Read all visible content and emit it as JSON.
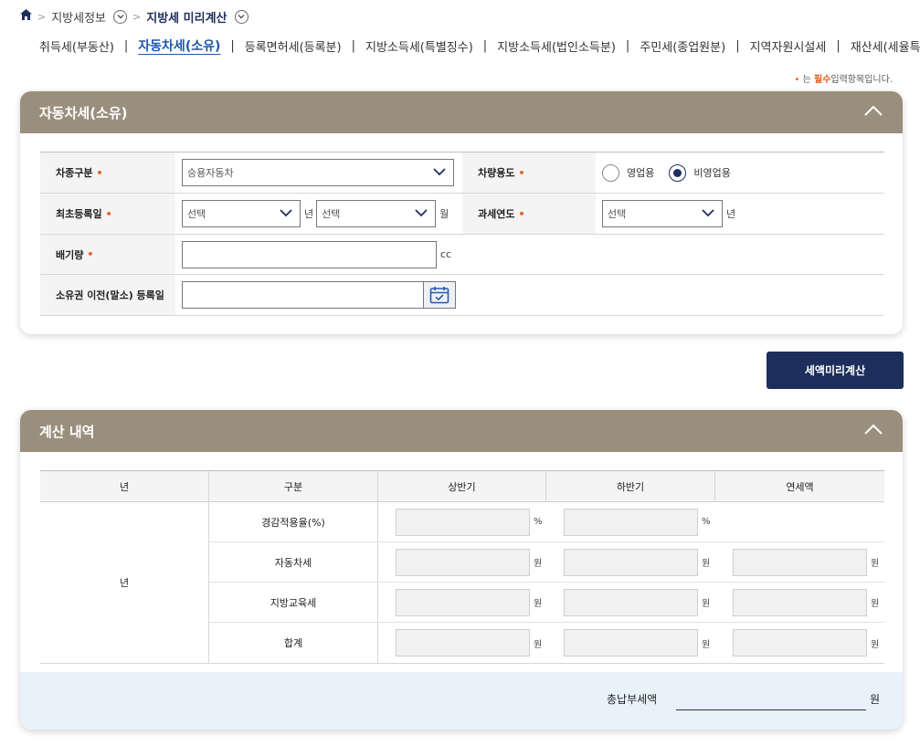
{
  "breadcrumb": {
    "level1": "지방세정보",
    "level2": "지방세 미리계산"
  },
  "tabs": [
    {
      "label": "취득세(부동산)",
      "active": false
    },
    {
      "label": "자동차세(소유)",
      "active": true
    },
    {
      "label": "등록면허세(등록분)",
      "active": false
    },
    {
      "label": "지방소득세(특별징수)",
      "active": false
    },
    {
      "label": "지방소득세(법인소득분)",
      "active": false
    },
    {
      "label": "주민세(종업원분)",
      "active": false
    },
    {
      "label": "지역자원시설세",
      "active": false
    },
    {
      "label": "재산세(세율특례)",
      "active": false
    }
  ],
  "required_note": {
    "prefix": "는",
    "required": "필수",
    "suffix": "입력항목입니다."
  },
  "form_panel": {
    "title": "자동차세(소유)",
    "vehicle_type": {
      "label": "차종구분",
      "value": "승용자동차"
    },
    "vehicle_use": {
      "label": "차량용도",
      "options": [
        "영업용",
        "비영업용"
      ],
      "selected": "비영업용"
    },
    "first_reg": {
      "label": "최초등록일",
      "year_value": "선택",
      "year_unit": "년",
      "month_value": "선택",
      "month_unit": "월"
    },
    "tax_year": {
      "label": "과세연도",
      "value": "선택",
      "unit": "년"
    },
    "displacement": {
      "label": "배기량",
      "value": "",
      "unit": "cc"
    },
    "transfer_date": {
      "label": "소유권 이전(말소) 등록일",
      "value": ""
    }
  },
  "calc_button": "세액미리계산",
  "result_panel": {
    "title": "계산 내역",
    "headers": [
      "년",
      "구분",
      "상반기",
      "하반기",
      "연세액"
    ],
    "year_cell": "년",
    "rows": [
      {
        "label": "경감적용율(%)",
        "unit_first": "%",
        "unit_second": "%",
        "unit_annual": ""
      },
      {
        "label": "자동차세",
        "unit_first": "원",
        "unit_second": "원",
        "unit_annual": "원"
      },
      {
        "label": "지방교육세",
        "unit_first": "원",
        "unit_second": "원",
        "unit_annual": "원"
      },
      {
        "label": "합계",
        "unit_first": "원",
        "unit_second": "원",
        "unit_annual": "원"
      }
    ],
    "total_label": "총납부세액",
    "total_unit": "원"
  },
  "colors": {
    "header_bg": "#9a8f7d",
    "primary": "#1d2e5c",
    "accent_tab": "#1e58a8",
    "required": "#e65a1f",
    "total_bg": "#e9f1fa"
  }
}
